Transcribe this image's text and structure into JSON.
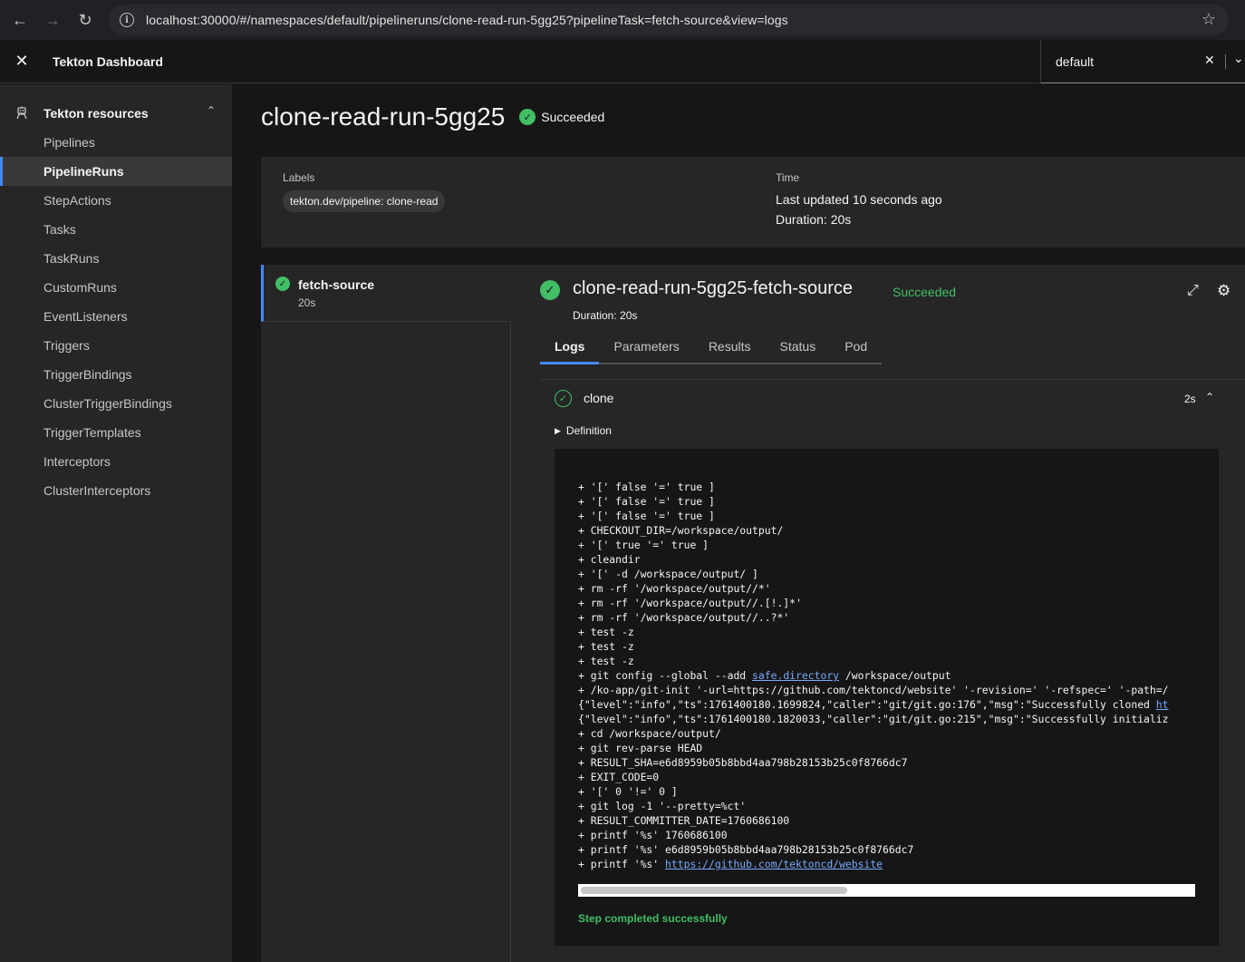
{
  "browser": {
    "url": "localhost:30000/#/namespaces/default/pipelineruns/clone-read-run-5gg25?pipelineTask=fetch-source&view=logs"
  },
  "header": {
    "title": "Tekton Dashboard",
    "namespace": "default"
  },
  "sidebar": {
    "section": "Tekton resources",
    "items": [
      {
        "label": "Pipelines"
      },
      {
        "label": "PipelineRuns"
      },
      {
        "label": "StepActions"
      },
      {
        "label": "Tasks"
      },
      {
        "label": "TaskRuns"
      },
      {
        "label": "CustomRuns"
      },
      {
        "label": "EventListeners"
      },
      {
        "label": "Triggers"
      },
      {
        "label": "TriggerBindings"
      },
      {
        "label": "ClusterTriggerBindings"
      },
      {
        "label": "TriggerTemplates"
      },
      {
        "label": "Interceptors"
      },
      {
        "label": "ClusterInterceptors"
      }
    ]
  },
  "run": {
    "name": "clone-read-run-5gg25",
    "status": "Succeeded",
    "labels_heading": "Labels",
    "label_tag": "tekton.dev/pipeline: clone-read",
    "time_heading": "Time",
    "last_updated": "Last updated 10 seconds ago",
    "duration": "Duration: 20s"
  },
  "task_list": [
    {
      "name": "fetch-source",
      "duration": "20s"
    }
  ],
  "task_details": {
    "title": "clone-read-run-5gg25-fetch-source",
    "status": "Succeeded",
    "duration": "Duration: 20s",
    "tabs": [
      {
        "label": "Logs"
      },
      {
        "label": "Parameters"
      },
      {
        "label": "Results"
      },
      {
        "label": "Status"
      },
      {
        "label": "Pod"
      }
    ],
    "step": {
      "name": "clone",
      "duration": "2s",
      "definition_label": "Definition",
      "completed_text": "Step completed successfully"
    }
  },
  "log_lines": [
    "+ '[' false '=' true ]",
    "+ '[' false '=' true ]",
    "+ '[' false '=' true ]",
    "+ CHECKOUT_DIR=/workspace/output/",
    "+ '[' true '=' true ]",
    "+ cleandir",
    "+ '[' -d /workspace/output/ ]",
    "+ rm -rf '/workspace/output//*'",
    "+ rm -rf '/workspace/output//.[!.]*'",
    "+ rm -rf '/workspace/output//..?*'",
    "+ test -z",
    "+ test -z",
    "+ test -z",
    "+ git config --global --add ",
    "+ /ko-app/git-init '-url=https://github.com/tektoncd/website' '-revision=' '-refspec=' '-path=/",
    "{\"level\":\"info\",\"ts\":1761400180.1699824,\"caller\":\"git/git.go:176\",\"msg\":\"Successfully cloned ",
    "{\"level\":\"info\",\"ts\":1761400180.1820033,\"caller\":\"git/git.go:215\",\"msg\":\"Successfully initializ",
    "+ cd /workspace/output/",
    "+ git rev-parse HEAD",
    "+ RESULT_SHA=e6d8959b05b8bbd4aa798b28153b25c0f8766dc7",
    "+ EXIT_CODE=0",
    "+ '[' 0 '!=' 0 ]",
    "+ git log -1 '--pretty=%ct'",
    "+ RESULT_COMMITTER_DATE=1760686100",
    "+ printf '%s' 1760686100",
    "+ printf '%s' e6d8959b05b8bbd4aa798b28153b25c0f8766dc7",
    "+ printf '%s' "
  ],
  "log_links": {
    "safe_directory": "safe.directory",
    "safe_directory_suffix": " /workspace/output",
    "cloned_link": "ht",
    "website_link": "https://github.com/tektoncd/website"
  },
  "colors": {
    "success": "#42be65",
    "accent": "#4589ff",
    "link": "#78a9ff"
  }
}
